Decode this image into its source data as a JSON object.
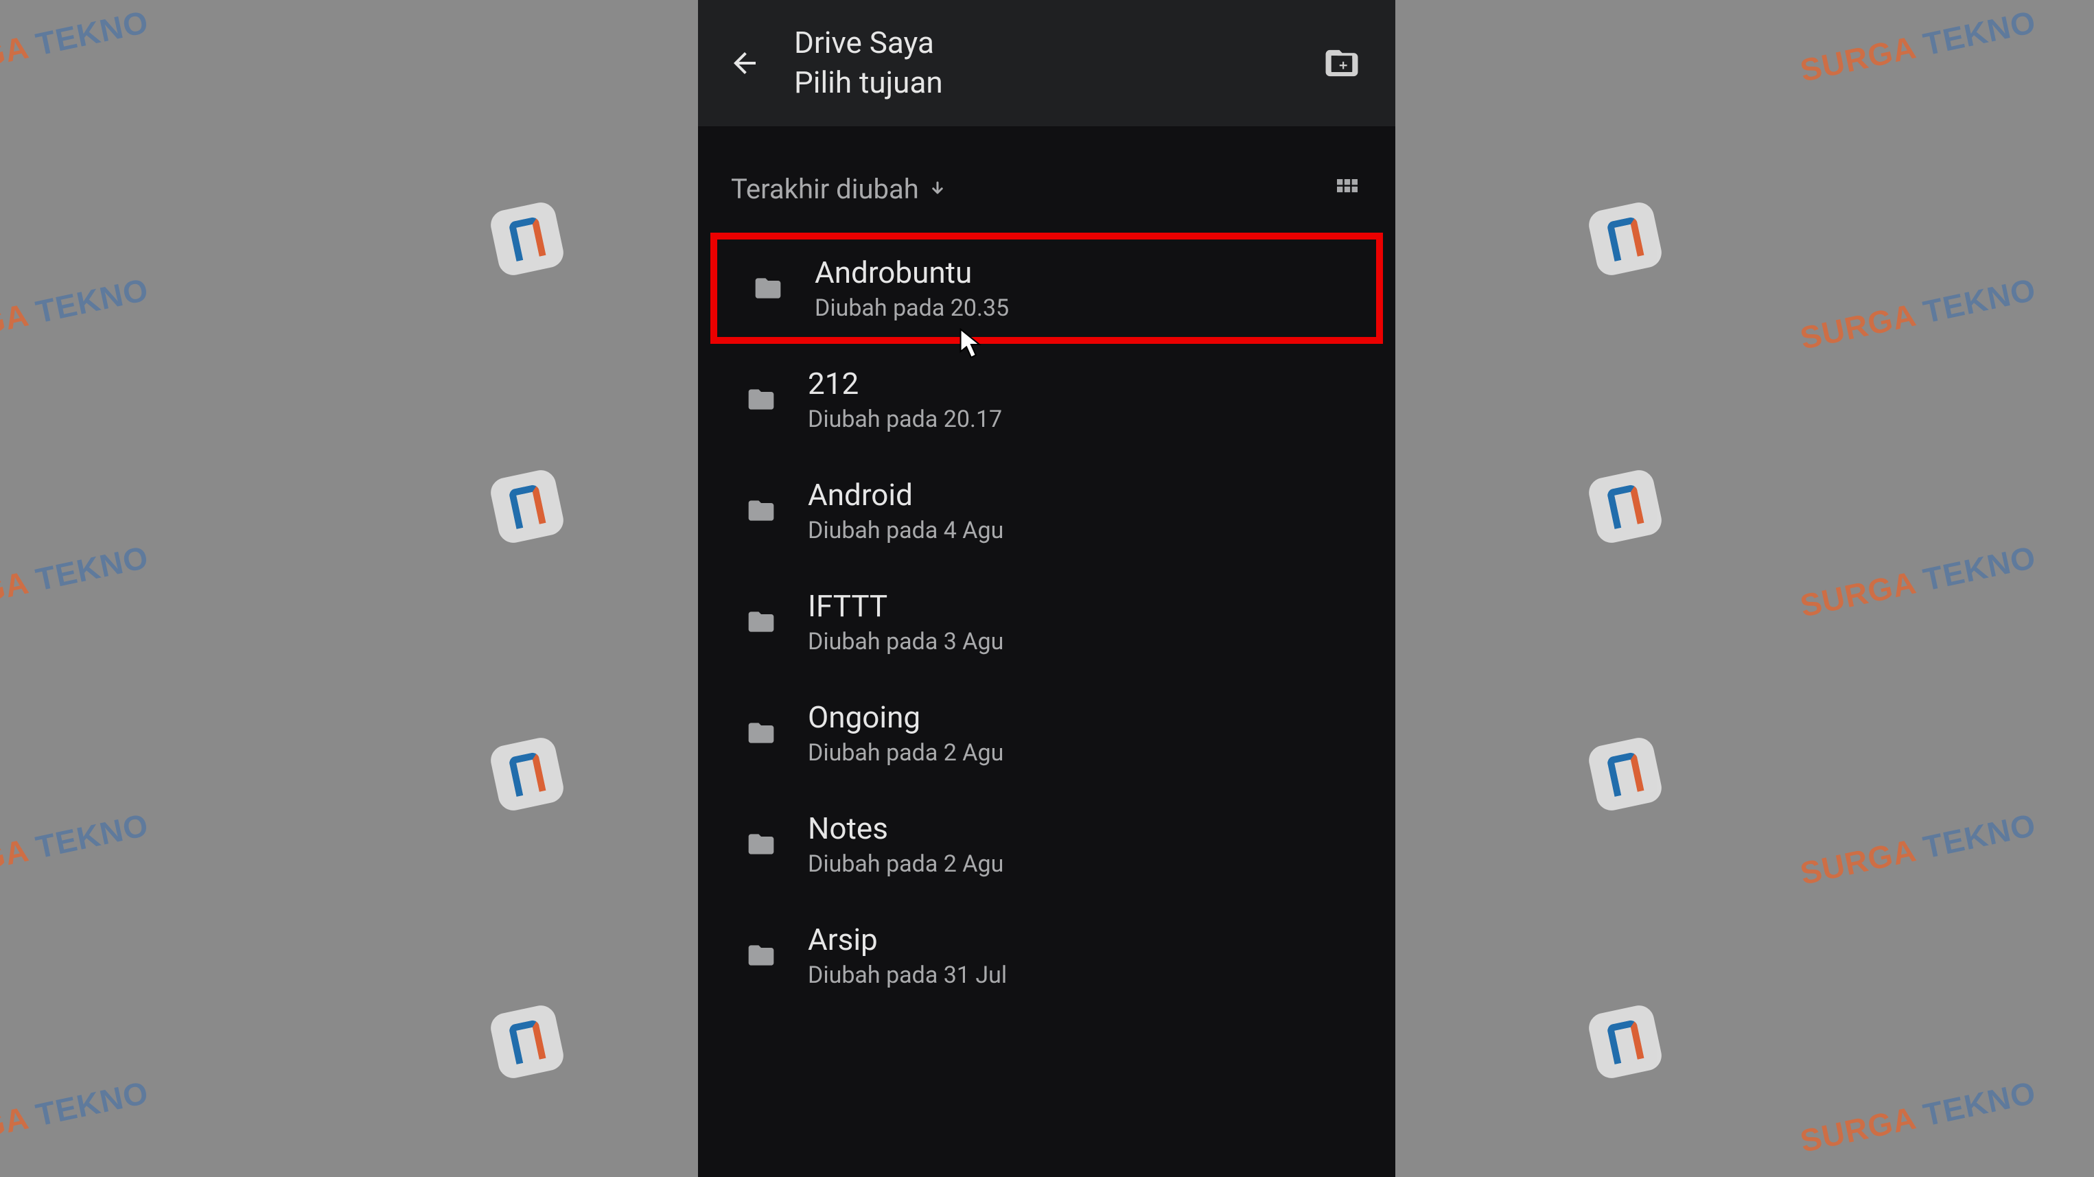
{
  "header": {
    "title": "Drive Saya",
    "subtitle": "Pilih tujuan"
  },
  "sort": {
    "label": "Terakhir diubah"
  },
  "folders": [
    {
      "name": "Androbuntu",
      "modified": "Diubah pada 20.35",
      "highlighted": true
    },
    {
      "name": "212",
      "modified": "Diubah pada 20.17",
      "highlighted": false
    },
    {
      "name": "Android",
      "modified": "Diubah pada 4 Agu",
      "highlighted": false
    },
    {
      "name": "IFTTT",
      "modified": "Diubah pada 3 Agu",
      "highlighted": false
    },
    {
      "name": "Ongoing",
      "modified": "Diubah pada 2 Agu",
      "highlighted": false
    },
    {
      "name": "Notes",
      "modified": "Diubah pada 2 Agu",
      "highlighted": false
    },
    {
      "name": "Arsip",
      "modified": "Diubah pada 31 Jul",
      "highlighted": false
    }
  ],
  "watermark": {
    "text_orange": "SURGA",
    "text_blue": "TEKNO"
  }
}
